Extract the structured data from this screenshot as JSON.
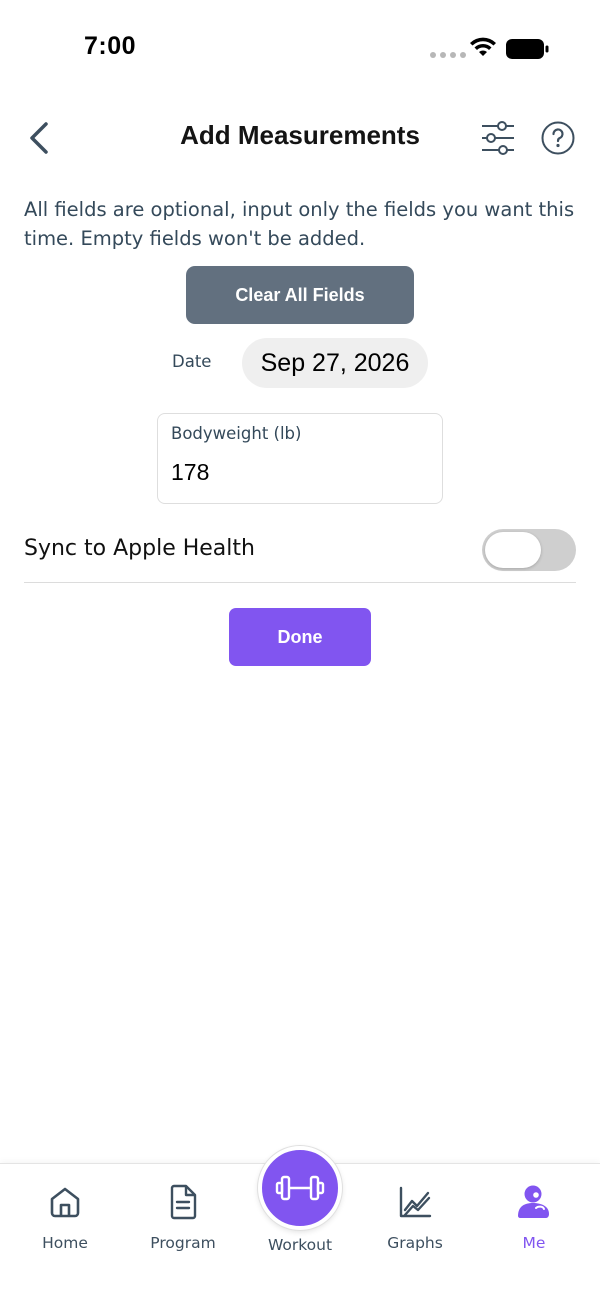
{
  "status_bar": {
    "time": "7:00"
  },
  "header": {
    "title": "Add Measurements"
  },
  "form": {
    "description": "All fields are optional, input only the fields you want this time. Empty fields won't be added.",
    "clear_label": "Clear All Fields",
    "date_label": "Date",
    "date_value": "Sep 27, 2026",
    "bodyweight_label": "Bodyweight (lb)",
    "bodyweight_value": "178",
    "sync_label": "Sync to Apple Health",
    "sync_enabled": false,
    "done_label": "Done"
  },
  "tabs": [
    {
      "label": "Home",
      "icon": "home-icon"
    },
    {
      "label": "Program",
      "icon": "document-icon"
    },
    {
      "label": "Workout",
      "icon": "dumbbell-icon"
    },
    {
      "label": "Graphs",
      "icon": "graph-icon"
    },
    {
      "label": "Me",
      "icon": "profile-icon",
      "active": true
    }
  ],
  "colors": {
    "accent": "#8155f0",
    "clear_button": "#62707f",
    "text_secondary": "#34495a"
  }
}
